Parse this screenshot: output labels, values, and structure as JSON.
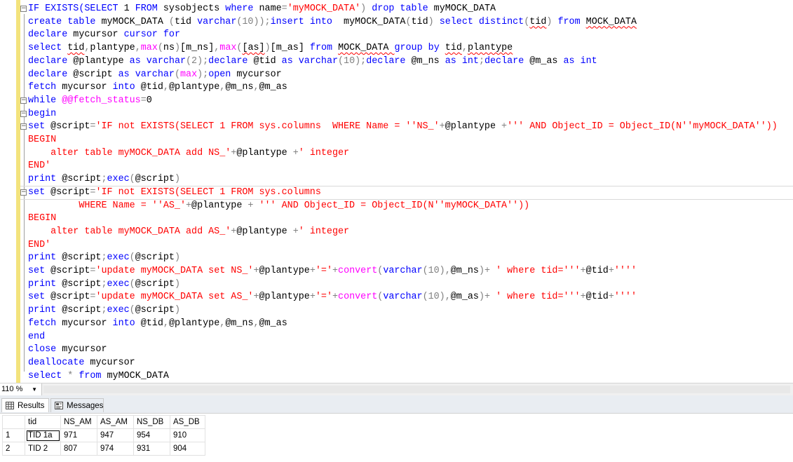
{
  "editor": {
    "lines": [
      [
        [
          "IF EXISTS(",
          "kw"
        ],
        [
          "SELECT ",
          "kw"
        ],
        [
          "1 ",
          "n"
        ],
        [
          "FROM ",
          "kw"
        ],
        [
          "sysobjects ",
          "n"
        ],
        [
          "where ",
          "kw"
        ],
        [
          "name",
          "n"
        ],
        [
          "=",
          "op"
        ],
        [
          "'myMOCK_DATA'",
          "str"
        ],
        [
          ") ",
          "op"
        ],
        [
          "drop table ",
          "kw"
        ],
        [
          "myMOCK_DATA",
          "n"
        ]
      ],
      [
        [
          "create table ",
          "kw"
        ],
        [
          "myMOCK_DATA ",
          "n"
        ],
        [
          "(",
          "op"
        ],
        [
          "tid ",
          "n"
        ],
        [
          "varchar",
          "kw"
        ],
        [
          "(10));",
          "op"
        ],
        [
          "insert into ",
          "kw"
        ],
        [
          " myMOCK_DATA",
          "n"
        ],
        [
          "(",
          "op"
        ],
        [
          "tid",
          "n"
        ],
        [
          ") ",
          "op"
        ],
        [
          "select distinct",
          "kw"
        ],
        [
          "(",
          "op"
        ],
        [
          "tid",
          "sq"
        ],
        [
          ") ",
          "op"
        ],
        [
          "from ",
          "kw"
        ],
        [
          "MOCK_DATA",
          "sq"
        ]
      ],
      [
        [
          "declare ",
          "kw"
        ],
        [
          "mycursor ",
          "n"
        ],
        [
          "cursor for",
          "kw"
        ]
      ],
      [
        [
          "select ",
          "kw"
        ],
        [
          "tid",
          "sq"
        ],
        [
          ",",
          "op"
        ],
        [
          "plantype",
          "n"
        ],
        [
          ",",
          "op"
        ],
        [
          "max",
          "fn"
        ],
        [
          "(",
          "op"
        ],
        [
          "ns",
          "n"
        ],
        [
          ")",
          "op"
        ],
        [
          "[m_ns]",
          "n"
        ],
        [
          ",",
          "op"
        ],
        [
          "max",
          "fn"
        ],
        [
          "(",
          "op"
        ],
        [
          "[as]",
          "sq"
        ],
        [
          ")",
          "op"
        ],
        [
          "[m_as] ",
          "n"
        ],
        [
          "from ",
          "kw"
        ],
        [
          "MOCK_DATA ",
          "sq"
        ],
        [
          "group by ",
          "kw"
        ],
        [
          "tid",
          "sq"
        ],
        [
          ",",
          "op"
        ],
        [
          "plantype",
          "sq"
        ]
      ],
      [
        [
          "declare ",
          "kw"
        ],
        [
          "@plantype ",
          "n"
        ],
        [
          "as ",
          "kw"
        ],
        [
          "varchar",
          "kw"
        ],
        [
          "(2);",
          "op"
        ],
        [
          "declare ",
          "kw"
        ],
        [
          "@tid ",
          "n"
        ],
        [
          "as ",
          "kw"
        ],
        [
          "varchar",
          "kw"
        ],
        [
          "(10);",
          "op"
        ],
        [
          "declare ",
          "kw"
        ],
        [
          "@m_ns ",
          "n"
        ],
        [
          "as ",
          "kw"
        ],
        [
          "int",
          "kw"
        ],
        [
          ";",
          "op"
        ],
        [
          "declare ",
          "kw"
        ],
        [
          "@m_as ",
          "n"
        ],
        [
          "as ",
          "kw"
        ],
        [
          "int",
          "kw"
        ]
      ],
      [
        [
          "declare ",
          "kw"
        ],
        [
          "@script ",
          "n"
        ],
        [
          "as ",
          "kw"
        ],
        [
          "varchar",
          "kw"
        ],
        [
          "(",
          "op"
        ],
        [
          "max",
          "fn"
        ],
        [
          ");",
          "op"
        ],
        [
          "open ",
          "kw"
        ],
        [
          "mycursor",
          "n"
        ]
      ],
      [
        [
          "fetch ",
          "kw"
        ],
        [
          "mycursor ",
          "n"
        ],
        [
          "into ",
          "kw"
        ],
        [
          "@tid",
          "n"
        ],
        [
          ",",
          "op"
        ],
        [
          "@plantype",
          "n"
        ],
        [
          ",",
          "op"
        ],
        [
          "@m_ns",
          "n"
        ],
        [
          ",",
          "op"
        ],
        [
          "@m_as",
          "n"
        ]
      ],
      [
        [
          "while ",
          "kw"
        ],
        [
          "@@fetch_status",
          "glob"
        ],
        [
          "=",
          "op"
        ],
        [
          "0",
          "n"
        ]
      ],
      [
        [
          "begin",
          "kw"
        ]
      ],
      [
        [
          "set ",
          "kw"
        ],
        [
          "@script",
          "n"
        ],
        [
          "=",
          "op"
        ],
        [
          "'IF not EXISTS(SELECT 1 FROM sys.columns  WHERE Name = ''NS_'",
          "str"
        ],
        [
          "+",
          "op"
        ],
        [
          "@plantype ",
          "n"
        ],
        [
          "+",
          "op"
        ],
        [
          "''' AND Object_ID = Object_ID(N''myMOCK_DATA''))",
          "str"
        ]
      ],
      [
        [
          "BEGIN",
          "str"
        ]
      ],
      [
        [
          "    alter table myMOCK_DATA add NS_'",
          "str"
        ],
        [
          "+",
          "op"
        ],
        [
          "@plantype ",
          "n"
        ],
        [
          "+",
          "op"
        ],
        [
          "' integer",
          "str"
        ]
      ],
      [
        [
          "END'",
          "str"
        ]
      ],
      [
        [
          "print ",
          "kw"
        ],
        [
          "@script",
          "n"
        ],
        [
          ";",
          "op"
        ],
        [
          "exec",
          "kw"
        ],
        [
          "(",
          "op"
        ],
        [
          "@script",
          "n"
        ],
        [
          ")",
          "op"
        ]
      ],
      [
        [
          "set ",
          "kw"
        ],
        [
          "@script",
          "n"
        ],
        [
          "=",
          "op"
        ],
        [
          "'IF not EXISTS(SELECT 1 FROM sys.columns",
          "str"
        ]
      ],
      [
        [
          "         WHERE Name = ''AS_'",
          "str"
        ],
        [
          "+",
          "op"
        ],
        [
          "@plantype ",
          "n"
        ],
        [
          "+ ",
          "op"
        ],
        [
          "''' AND Object_ID = Object_ID(N''myMOCK_DATA''))",
          "str"
        ]
      ],
      [
        [
          "BEGIN",
          "str"
        ]
      ],
      [
        [
          "    alter table myMOCK_DATA add AS_'",
          "str"
        ],
        [
          "+",
          "op"
        ],
        [
          "@plantype ",
          "n"
        ],
        [
          "+",
          "op"
        ],
        [
          "' integer",
          "str"
        ]
      ],
      [
        [
          "END'",
          "str"
        ]
      ],
      [
        [
          "print ",
          "kw"
        ],
        [
          "@script",
          "n"
        ],
        [
          ";",
          "op"
        ],
        [
          "exec",
          "kw"
        ],
        [
          "(",
          "op"
        ],
        [
          "@script",
          "n"
        ],
        [
          ")",
          "op"
        ]
      ],
      [
        [
          "set ",
          "kw"
        ],
        [
          "@script",
          "n"
        ],
        [
          "=",
          "op"
        ],
        [
          "'update myMOCK_DATA set NS_'",
          "str"
        ],
        [
          "+",
          "op"
        ],
        [
          "@plantype",
          "n"
        ],
        [
          "+",
          "op"
        ],
        [
          "'='",
          "str"
        ],
        [
          "+",
          "op"
        ],
        [
          "convert",
          "fn"
        ],
        [
          "(",
          "op"
        ],
        [
          "varchar",
          "kw"
        ],
        [
          "(10),",
          "op"
        ],
        [
          "@m_ns",
          "n"
        ],
        [
          ")+ ",
          "op"
        ],
        [
          "' where tid='''",
          "str"
        ],
        [
          "+",
          "op"
        ],
        [
          "@tid",
          "n"
        ],
        [
          "+",
          "op"
        ],
        [
          "''''",
          "str"
        ]
      ],
      [
        [
          "print ",
          "kw"
        ],
        [
          "@script",
          "n"
        ],
        [
          ";",
          "op"
        ],
        [
          "exec",
          "kw"
        ],
        [
          "(",
          "op"
        ],
        [
          "@script",
          "n"
        ],
        [
          ")",
          "op"
        ]
      ],
      [
        [
          "set ",
          "kw"
        ],
        [
          "@script",
          "n"
        ],
        [
          "=",
          "op"
        ],
        [
          "'update myMOCK_DATA set AS_'",
          "str"
        ],
        [
          "+",
          "op"
        ],
        [
          "@plantype",
          "n"
        ],
        [
          "+",
          "op"
        ],
        [
          "'='",
          "str"
        ],
        [
          "+",
          "op"
        ],
        [
          "convert",
          "fn"
        ],
        [
          "(",
          "op"
        ],
        [
          "varchar",
          "kw"
        ],
        [
          "(10),",
          "op"
        ],
        [
          "@m_as",
          "n"
        ],
        [
          ")+ ",
          "op"
        ],
        [
          "' where tid='''",
          "str"
        ],
        [
          "+",
          "op"
        ],
        [
          "@tid",
          "n"
        ],
        [
          "+",
          "op"
        ],
        [
          "''''",
          "str"
        ]
      ],
      [
        [
          "print ",
          "kw"
        ],
        [
          "@script",
          "n"
        ],
        [
          ";",
          "op"
        ],
        [
          "exec",
          "kw"
        ],
        [
          "(",
          "op"
        ],
        [
          "@script",
          "n"
        ],
        [
          ")",
          "op"
        ]
      ],
      [
        [
          "fetch ",
          "kw"
        ],
        [
          "mycursor ",
          "n"
        ],
        [
          "into ",
          "kw"
        ],
        [
          "@tid",
          "n"
        ],
        [
          ",",
          "op"
        ],
        [
          "@plantype",
          "n"
        ],
        [
          ",",
          "op"
        ],
        [
          "@m_ns",
          "n"
        ],
        [
          ",",
          "op"
        ],
        [
          "@m_as",
          "n"
        ]
      ],
      [
        [
          "end",
          "kw"
        ]
      ],
      [
        [
          "close ",
          "kw"
        ],
        [
          "mycursor",
          "n"
        ]
      ],
      [
        [
          "deallocate ",
          "kw"
        ],
        [
          "mycursor",
          "n"
        ]
      ],
      [
        [
          "select ",
          "kw"
        ],
        [
          "* ",
          "op"
        ],
        [
          "from ",
          "kw"
        ],
        [
          "myMOCK_DATA",
          "n"
        ]
      ]
    ]
  },
  "status": {
    "zoom": "110 %"
  },
  "tabs": {
    "results": "Results",
    "messages": "Messages"
  },
  "results": {
    "columns": [
      "tid",
      "NS_AM",
      "AS_AM",
      "NS_DB",
      "AS_DB"
    ],
    "rows": [
      [
        "1",
        "TID 1a",
        "971",
        "947",
        "954",
        "910"
      ],
      [
        "2",
        "TID 2",
        "807",
        "974",
        "931",
        "904"
      ]
    ]
  }
}
